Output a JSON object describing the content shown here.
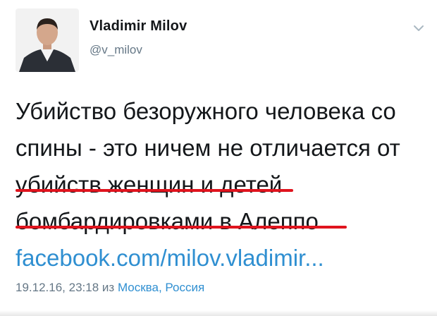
{
  "author": {
    "display_name": "Vladimir Milov",
    "handle": "@v_milov"
  },
  "tweet": {
    "lines": [
      "Убийство безоружного человека со",
      "спины - это ничем не отличается от",
      "убийств женщин и детей",
      "бомбардировками в Алеппо"
    ],
    "link": "facebook.com/milov.vladimir...",
    "timestamp": "19.12.16, 23:18",
    "from_word": "из",
    "location": "Москва, Россия"
  },
  "icons": {
    "avatar": "avatar-photo",
    "menu": "chevron-down-icon"
  },
  "colors": {
    "text": "#14171a",
    "secondary": "#657786",
    "link": "#2f8fd1",
    "underline": "#e0141e"
  }
}
